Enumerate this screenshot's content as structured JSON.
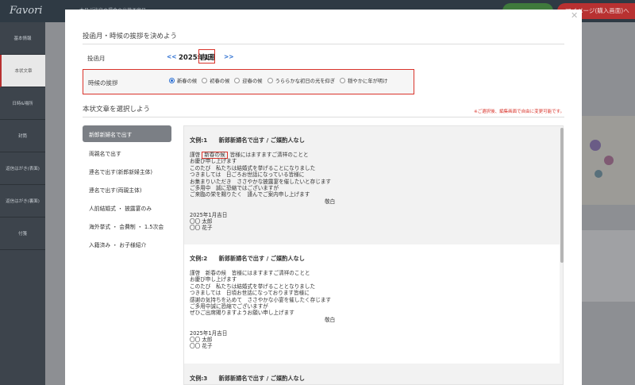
{
  "app": {
    "logo": "Favori",
    "top_note": "本日ご注文の場合の出荷予定日",
    "mypage_button": "マイページ(購入画面)へ"
  },
  "sidebar": {
    "items": [
      {
        "label": "基本情報"
      },
      {
        "label": "本状文章"
      },
      {
        "label": "日時&場所"
      },
      {
        "label": "封筒"
      },
      {
        "label": "返信はがき(表面)"
      },
      {
        "label": "返信はがき(裏面)"
      },
      {
        "label": "付箋"
      }
    ]
  },
  "modal": {
    "close_icon": "close-icon",
    "section1_title": "投函月・時候の挨拶を決めよう",
    "month_label": "投函月",
    "prev_link": "<<",
    "next_link": ">>",
    "year_month": "2025年1月",
    "day_value": "吉日",
    "greeting_label": "時候の挨拶",
    "greeting_options": [
      {
        "label": "新春の候",
        "selected": true
      },
      {
        "label": "初春の候",
        "selected": false
      },
      {
        "label": "迎春の候",
        "selected": false
      },
      {
        "label": "うららかな初日の光を仰ぎ",
        "selected": false
      },
      {
        "label": "穏やかに年が明け",
        "selected": false
      }
    ],
    "section2_title": "本状文章を選択しよう",
    "edit_note": "※ご選択後、編集画面で自由に変更可能です。",
    "templates": [
      {
        "label": "新郎新婦名で出す"
      },
      {
        "label": "両親名で出す"
      },
      {
        "label": "連名で出す(新郎新婦主体)"
      },
      {
        "label": "連名で出す(両親主体)"
      },
      {
        "label": "人前結婚式 ・ 披露宴のみ"
      },
      {
        "label": "海外挙式 ・ 会費制 ・ 1.5次会"
      },
      {
        "label": "入籍済み ・ お子様紹介"
      }
    ],
    "examples": [
      {
        "title": "文例:1　　新郎新婦名で出す / ご媒酌人なし",
        "greeting_prefix": "謹啓",
        "greeting_word": "新春の候",
        "greeting_rest": "皆様にはますますご清祥のことと",
        "lines": [
          "お慶び申し上げます",
          "このたび　私たちは結婚式を挙げることになりました",
          "つきましては　日ごろお世話になっている皆様に",
          "お集まりいただき　ささやかな披露宴を催したいと存じます",
          "ご多用中　誠に恐縮ではございますが",
          "ご来臨の栄を賜りたく　謹んでご案内申し上げます"
        ],
        "closing": "敬白",
        "date": "2025年1月吉日",
        "name1": "〇〇 太郎",
        "name2": "〇〇 花子"
      },
      {
        "title": "文例:2　　新郎新婦名で出す / ご媒酌人なし",
        "greeting_line": "謹啓　新春の候　皆様にはますますご清祥のことと",
        "lines": [
          "お慶び申し上げます",
          "このたび　私たちは結婚式を挙げることとなりました",
          "つきましては　日頃お世話になっております皆様に",
          "感謝の気持ちを込めて　ささやかな小宴を催したく存じます",
          "ご多用中誠に恐縮でございますが",
          "ぜひご出席賜りますようお願い申し上げます"
        ],
        "closing": "敬白",
        "date": "2025年1月吉日",
        "name1": "〇〇 太郎",
        "name2": "〇〇 花子"
      },
      {
        "title": "文例:3　　新郎新婦名で出す / ご媒酌人なし"
      }
    ]
  }
}
